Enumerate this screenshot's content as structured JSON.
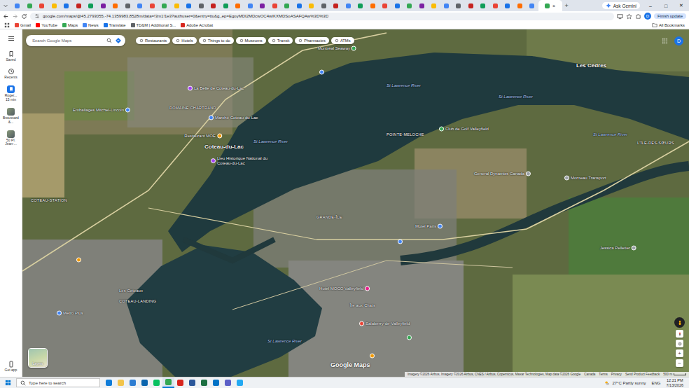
{
  "browser": {
    "tabs": [
      {
        "color": "#4285f4",
        "selected": false
      },
      {
        "color": "#34a853",
        "selected": false
      },
      {
        "color": "#ea4335",
        "selected": false
      },
      {
        "color": "#fbbc05",
        "selected": false
      },
      {
        "color": "#1a73e8",
        "selected": false
      },
      {
        "color": "#c5221f",
        "selected": false
      },
      {
        "color": "#0f9d58",
        "selected": false
      },
      {
        "color": "#7b1fa2",
        "selected": false
      },
      {
        "color": "#ff6d00",
        "selected": false
      },
      {
        "color": "#5f6368",
        "selected": false
      },
      {
        "color": "#4285f4",
        "selected": false
      },
      {
        "color": "#ea4335",
        "selected": false
      },
      {
        "color": "#34a853",
        "selected": false
      },
      {
        "color": "#fbbc05",
        "selected": false
      },
      {
        "color": "#1a73e8",
        "selected": false
      },
      {
        "color": "#5f6368",
        "selected": false
      },
      {
        "color": "#c5221f",
        "selected": false
      },
      {
        "color": "#0f9d58",
        "selected": false
      },
      {
        "color": "#ff6d00",
        "selected": false
      },
      {
        "color": "#4285f4",
        "selected": false
      },
      {
        "color": "#7b1fa2",
        "selected": false
      },
      {
        "color": "#ea4335",
        "selected": false
      },
      {
        "color": "#34a853",
        "selected": false
      },
      {
        "color": "#1a73e8",
        "selected": false
      },
      {
        "color": "#fbbc05",
        "selected": false
      },
      {
        "color": "#5f6368",
        "selected": false
      },
      {
        "color": "#c5221f",
        "selected": false
      },
      {
        "color": "#4285f4",
        "selected": false
      },
      {
        "color": "#0f9d58",
        "selected": false
      },
      {
        "color": "#ff6d00",
        "selected": false
      },
      {
        "color": "#ea4335",
        "selected": false
      },
      {
        "color": "#1a73e8",
        "selected": false
      },
      {
        "color": "#34a853",
        "selected": false
      },
      {
        "color": "#7b1fa2",
        "selected": false
      },
      {
        "color": "#fbbc05",
        "selected": false
      },
      {
        "color": "#4285f4",
        "selected": false
      },
      {
        "color": "#5f6368",
        "selected": false
      },
      {
        "color": "#c5221f",
        "selected": false
      },
      {
        "color": "#0f9d58",
        "selected": false
      },
      {
        "color": "#ea4335",
        "selected": false
      },
      {
        "color": "#1a73e8",
        "selected": false
      },
      {
        "color": "#ff6d00",
        "selected": false
      },
      {
        "color": "#4285f4",
        "selected": false
      },
      {
        "color": "#34a853",
        "selected": true
      }
    ],
    "tab_close": "×",
    "new_tab": "+",
    "ask_gemini": "Ask Gemini",
    "window_controls": [
      "–",
      "□",
      "✕"
    ],
    "url": "google.com/maps/@45.2793055,-74.1359983,8528m/data=!3m1!1e3?authuser=0&entry=ttu&g_ep=EgoyMDI2MDcwOC4wIKXMDSoASAFQAw%3D%3D",
    "finish_update": "Finish update",
    "avatar": "D",
    "bookmarks": [
      {
        "label": "Gmail",
        "color": "#ea4335"
      },
      {
        "label": "YouTube",
        "color": "#ff0000"
      },
      {
        "label": "Maps",
        "color": "#34a853"
      },
      {
        "label": "News",
        "color": "#4285f4"
      },
      {
        "label": "Translate",
        "color": "#1a73e8"
      },
      {
        "label": "TD&M | Additional S...",
        "color": "#5f6368"
      },
      {
        "label": "Adobe Acrobat",
        "color": "#d7261e"
      }
    ],
    "all_bookmarks": "All Bookmarks"
  },
  "maps": {
    "search_placeholder": "Search Google Maps",
    "chips": [
      "Restaurants",
      "Hotels",
      "Things to do",
      "Museums",
      "Transit",
      "Pharmacies",
      "ATMs"
    ],
    "rail": [
      {
        "label": "Saved",
        "kind": "saved"
      },
      {
        "label": "Recents",
        "kind": "recents"
      }
    ],
    "recents": [
      {
        "label": "Roger...",
        "sub": "15 min",
        "kind": "transit"
      },
      {
        "label": "Broussard &...",
        "sub": "",
        "kind": "photo"
      },
      {
        "label": "50 Pl. Jean-...",
        "sub": "",
        "kind": "photo"
      }
    ],
    "get_app": "Get app",
    "account": "D",
    "places": [
      {
        "name": "Les Cèdres",
        "kind": "town"
      },
      {
        "name": "St Lawrence River",
        "kind": "water"
      },
      {
        "name": "St Lawrence River",
        "kind": "water"
      },
      {
        "name": "St Lawrence River",
        "kind": "water"
      },
      {
        "name": "St Lawrence River",
        "kind": "water"
      },
      {
        "name": "St Lawrence River",
        "kind": "water"
      },
      {
        "name": "POINTE-MELOCHE",
        "kind": "area"
      },
      {
        "name": "Club de Golf Valleyfield",
        "kind": "pin",
        "color": "#34a853"
      },
      {
        "name": "L'ÎLE-DES-SŒURS",
        "kind": "area"
      },
      {
        "name": "General Dynamics Canada",
        "kind": "pin",
        "color": "#9aa0a6"
      },
      {
        "name": "Morneau Transport",
        "kind": "pin",
        "color": "#9aa0a6"
      },
      {
        "name": "La Belle de Coteau-du-Lac",
        "kind": "pin",
        "color": "#a142f4"
      },
      {
        "name": "DOMAINE CHARTRAND",
        "kind": "area"
      },
      {
        "name": "Emballages Mitchel-Lincoln",
        "kind": "pin",
        "color": "#4285f4"
      },
      {
        "name": "Marché Coteau-du-Lac",
        "kind": "pin",
        "color": "#4285f4"
      },
      {
        "name": "Restaurant MOE",
        "kind": "pin",
        "color": "#f29900"
      },
      {
        "name": "Coteau-du-Lac",
        "kind": "town"
      },
      {
        "name": "Lieu Historique National du Coteau-du-Lac",
        "kind": "pin",
        "color": "#a142f4"
      },
      {
        "name": "COTEAU-STATION",
        "kind": "area"
      },
      {
        "name": "GRANDE-ÎLE",
        "kind": "area"
      },
      {
        "name": "Motel Paris",
        "kind": "pin",
        "color": "#4285f4"
      },
      {
        "kind": "dot",
        "color": "#4285f4"
      },
      {
        "name": "Hotel MOCO Valleyfield",
        "kind": "pin",
        "color": "#e91e8c"
      },
      {
        "name": "Salaberry-de-Valleyfield",
        "kind": "pin",
        "color": "#ea4335"
      },
      {
        "name": "Jessica Pelletier",
        "kind": "pin",
        "color": "#9aa0a6"
      },
      {
        "name": "Les Coteaux",
        "kind": "area"
      },
      {
        "name": "COTEAU-LANDING",
        "kind": "area"
      },
      {
        "name": "Metro Plus",
        "kind": "pin",
        "color": "#4285f4"
      },
      {
        "name": "Île aux Chats",
        "kind": "area"
      },
      {
        "kind": "dot",
        "color": "#f29900"
      },
      {
        "kind": "dot",
        "color": "#f29900"
      },
      {
        "kind": "dot",
        "color": "#34a853"
      },
      {
        "kind": "dot",
        "color": "#4285f4"
      },
      {
        "name": "Montréal Seaway",
        "kind": "pin",
        "color": "#34a853"
      }
    ],
    "layers": "Layers",
    "attribution": [
      "Imagery ©2026 Airbus, Imagery ©2026 Airbus, CNES / Airbus, Copernicus, Maxar Technologies, Map data ©2026 Google",
      "Canada",
      "Terms",
      "Privacy",
      "Send Product Feedback"
    ],
    "scale": "500 m",
    "zoom": [
      "+",
      "−"
    ],
    "watermark": "Google Maps"
  },
  "taskbar": {
    "search": "Type here to search",
    "apps": [
      {
        "color": "#0f7cd9",
        "selected": false
      },
      {
        "color": "#f2c44b",
        "selected": false
      },
      {
        "color": "#2d7dd2",
        "selected": false
      },
      {
        "color": "#0a64ad",
        "selected": false
      },
      {
        "color": "#07c160",
        "selected": false
      },
      {
        "color": "#34a853",
        "selected": true
      },
      {
        "color": "#d7261e",
        "selected": false
      },
      {
        "color": "#2b579a",
        "selected": false
      },
      {
        "color": "#1d6f42",
        "selected": false
      },
      {
        "color": "#0072c6",
        "selected": false
      },
      {
        "color": "#5b5fc7",
        "selected": false
      },
      {
        "color": "#23a9f2",
        "selected": false
      }
    ],
    "weather": "27°C Partly sunny",
    "lang": "ENG",
    "time": "12:21 PM",
    "date": "7/13/2026"
  }
}
